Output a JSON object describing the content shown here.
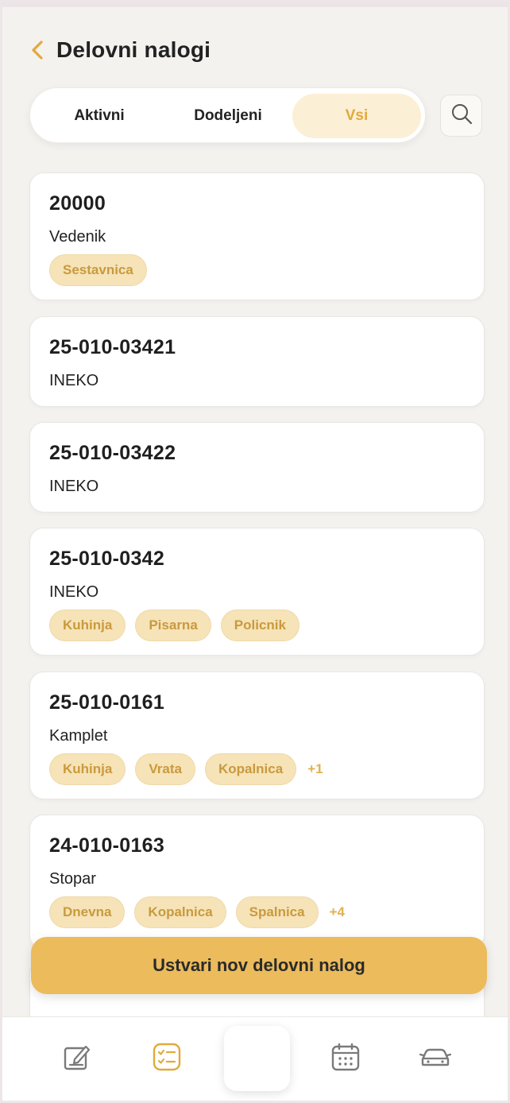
{
  "header": {
    "title": "Delovni nalogi"
  },
  "tabs": [
    {
      "label": "Aktivni",
      "selected": false
    },
    {
      "label": "Dodeljeni",
      "selected": false
    },
    {
      "label": "Vsi",
      "selected": true
    }
  ],
  "orders": [
    {
      "number": "20000",
      "client": "Vedenik",
      "tags": [
        "Sestavnica"
      ],
      "more": ""
    },
    {
      "number": "25-010-03421",
      "client": "INEKO",
      "tags": [],
      "more": ""
    },
    {
      "number": "25-010-03422",
      "client": "INEKO",
      "tags": [],
      "more": ""
    },
    {
      "number": "25-010-0342",
      "client": "INEKO",
      "tags": [
        "Kuhinja",
        "Pisarna",
        "Policnik"
      ],
      "more": ""
    },
    {
      "number": "25-010-0161",
      "client": "Kamplet",
      "tags": [
        "Kuhinja",
        "Vrata",
        "Kopalnica"
      ],
      "more": "+1"
    },
    {
      "number": "24-010-0163",
      "client": "Stopar",
      "tags": [
        "Dnevna",
        "Kopalnica",
        "Spalnica"
      ],
      "more": "+4"
    }
  ],
  "cta": {
    "label": "Ustvari nov delovni nalog"
  },
  "nav": {
    "items": [
      {
        "icon": "edit-icon"
      },
      {
        "icon": "checklist-icon",
        "active": true
      },
      {
        "icon": "center-action"
      },
      {
        "icon": "calendar-icon"
      },
      {
        "icon": "car-icon"
      }
    ]
  },
  "colors": {
    "accent": "#ebbb5c",
    "tag_bg": "#f6e3b8",
    "tag_text": "#c99a3d",
    "background": "#f4f2ef"
  }
}
